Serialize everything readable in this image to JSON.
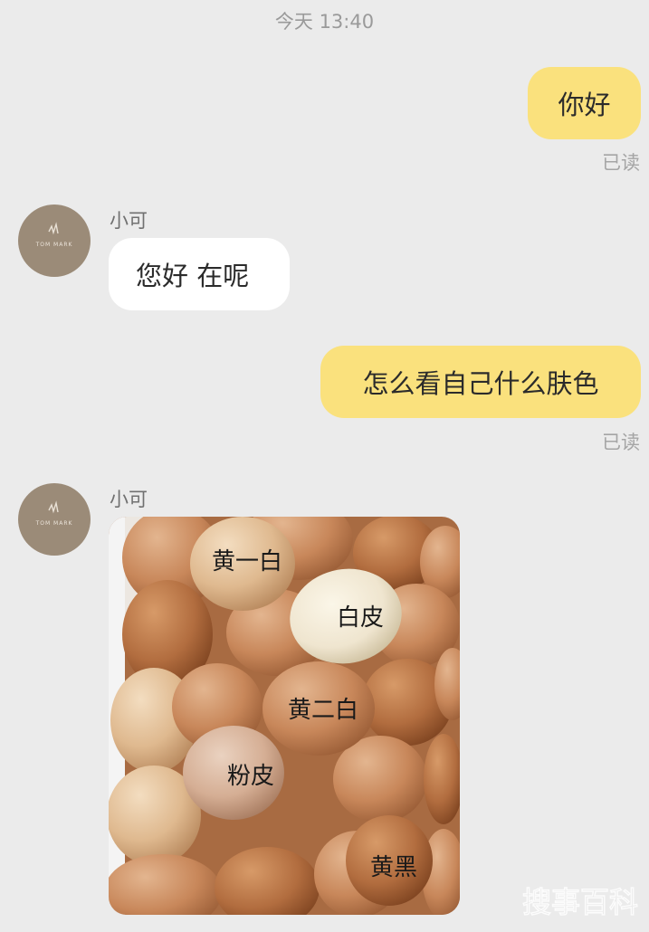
{
  "header": {
    "timestamp": "今天 13:40"
  },
  "contact": {
    "name": "小可",
    "avatar_text": "TOM MARK"
  },
  "messages": [
    {
      "side": "out",
      "text": "你好",
      "status": "已读"
    },
    {
      "side": "in",
      "text": "您好 在呢"
    },
    {
      "side": "out",
      "text": "怎么看自己什么肤色",
      "status": "已读"
    },
    {
      "side": "in",
      "type": "image",
      "labels": [
        "黄一白",
        "白皮",
        "黄二白",
        "粉皮",
        "黄黑"
      ]
    }
  ],
  "watermark": {
    "text": "搜事百科",
    "icon": "watermark-logo"
  },
  "colors": {
    "outgoing_bubble": "#fae17d",
    "incoming_bubble": "#ffffff",
    "background": "#ebebeb",
    "avatar": "#9b8b78"
  }
}
